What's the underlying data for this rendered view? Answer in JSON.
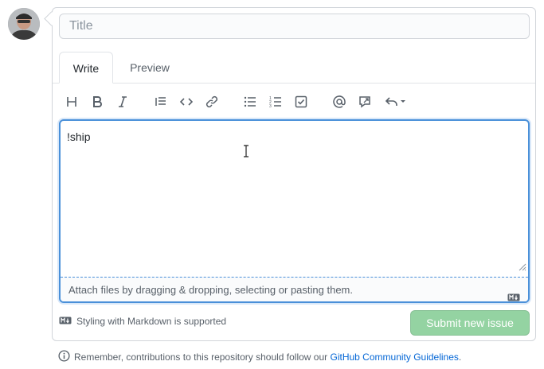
{
  "title_field": {
    "placeholder": "Title",
    "value": ""
  },
  "tabs": [
    {
      "label": "Write",
      "active": true
    },
    {
      "label": "Preview",
      "active": false
    }
  ],
  "toolbar": {
    "icons": [
      "heading-icon",
      "bold-icon",
      "italic-icon",
      "quote-icon",
      "code-icon",
      "link-icon",
      "unordered-list-icon",
      "ordered-list-icon",
      "task-list-icon",
      "mention-icon",
      "reference-icon",
      "reply-icon"
    ]
  },
  "editor": {
    "text": "!ship",
    "attach_hint": "Attach files by dragging & dropping, selecting or pasting them."
  },
  "markdown_note": "Styling with Markdown is supported",
  "submit_label": "Submit new issue",
  "footer": {
    "prefix": "Remember, contributions to this repository should follow our ",
    "link": "GitHub Community Guidelines",
    "suffix": "."
  },
  "colors": {
    "submit_bg": "#94d3a2",
    "link": "#0366d6",
    "focus_border": "#4a90d9"
  }
}
